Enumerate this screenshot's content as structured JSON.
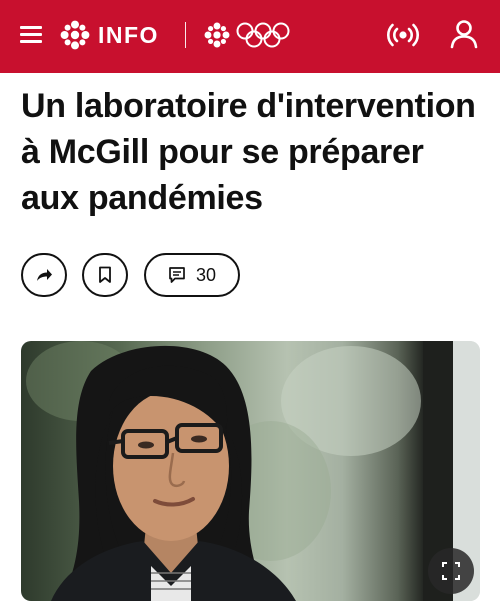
{
  "header": {
    "brand_label": "INFO",
    "background_color": "#c8102e",
    "icons": [
      "menu-icon",
      "cbc-gem-logo",
      "olympic-rings-logo",
      "live-radio-icon",
      "user-icon"
    ]
  },
  "article": {
    "title": "Un laboratoire d'intervention à McGill pour se préparer aux pandémies",
    "actions": {
      "comment_count": "30",
      "icons": [
        "share-icon",
        "bookmark-icon",
        "comment-icon"
      ]
    },
    "media": {
      "icons": [
        "expand-icon"
      ]
    }
  }
}
